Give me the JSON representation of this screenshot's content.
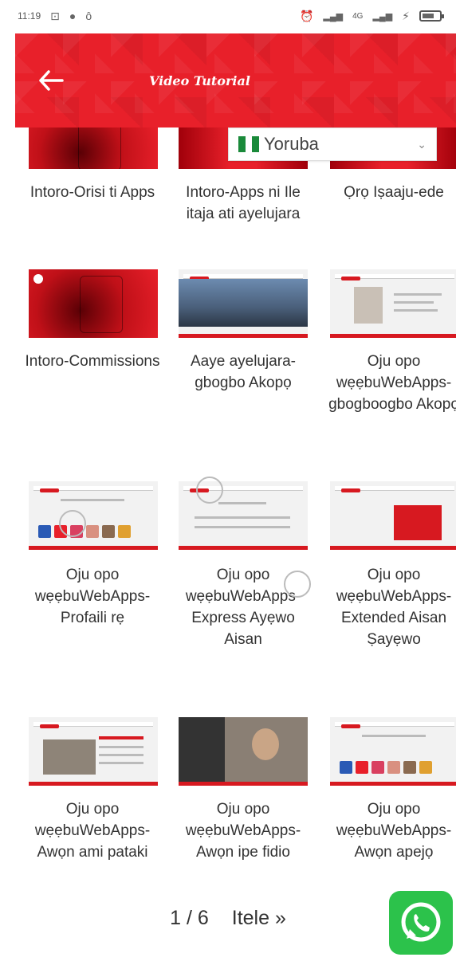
{
  "statusbar": {
    "time": "11:19",
    "right_text": "4G"
  },
  "appbar": {
    "title": "Video Tutorial",
    "back_icon": "arrow-left-icon"
  },
  "language": {
    "selected": "Yoruba",
    "flag_colors": [
      "#1a8a3a",
      "#ffffff",
      "#1a8a3a"
    ]
  },
  "videos": [
    {
      "label": "Intoro-Orisi ti Apps"
    },
    {
      "label": "Intoro-Apps ni Ile itaja ati ayelujara"
    },
    {
      "label": "Ọrọ Iṣaaju-ede"
    },
    {
      "label": "Intoro-Commissions"
    },
    {
      "label": "Aaye ayelujara-gbogbo Akopọ"
    },
    {
      "label": "Oju opo wẹẹbuWebApps-gbogboogbo Akopọ"
    },
    {
      "label": "Oju opo wẹẹbuWebApps- Profaili rẹ"
    },
    {
      "label": "Oju opo wẹẹbuWebApps-Express Ayẹwo Aisan"
    },
    {
      "label": "Oju opo wẹẹbuWebApps-Extended Aisan Ṣayẹwo"
    },
    {
      "label": "Oju opo wẹẹbuWebApps-Awọn ami pataki"
    },
    {
      "label": "Oju opo wẹẹbuWebApps-Awọn ipe fidio"
    },
    {
      "label": "Oju opo wẹẹbuWebApps-Awọn apejọ"
    }
  ],
  "pager": {
    "current": "1 / 6",
    "next_label": "Itele »"
  },
  "whatsapp": {
    "icon": "whatsapp-icon"
  }
}
